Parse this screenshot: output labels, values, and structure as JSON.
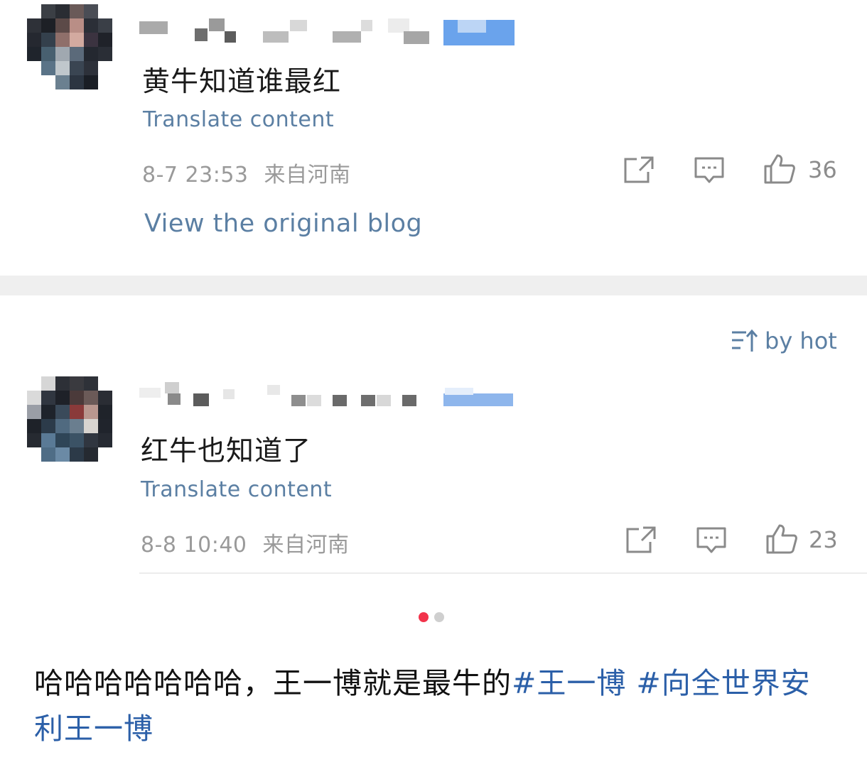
{
  "comments": [
    {
      "text": "黄牛知道谁最红",
      "translate_label": "Translate content",
      "date": "8-7 23:53",
      "location": "来自河南",
      "likes": "36"
    },
    {
      "text": "红牛也知道了",
      "translate_label": "Translate content",
      "date": "8-8 10:40",
      "location": "来自河南",
      "likes": "23"
    }
  ],
  "view_original_label": "View the original blog",
  "sort_label": "by hot",
  "pagination": {
    "active_index": 0,
    "total": 2,
    "active_color": "#f2334b",
    "inactive_color": "#cfcfcf"
  },
  "post": {
    "text": "哈哈哈哈哈哈哈，王一博就是最牛的",
    "hashtags": [
      "#王一博",
      "#向全世界安利王一博"
    ]
  },
  "colors": {
    "link": "#5b7fa3",
    "hashtag": "#2b5fa8",
    "meta": "#9a9a9a"
  },
  "icons": [
    "share-icon",
    "comment-icon",
    "thumbs-up-icon",
    "sort-icon"
  ]
}
